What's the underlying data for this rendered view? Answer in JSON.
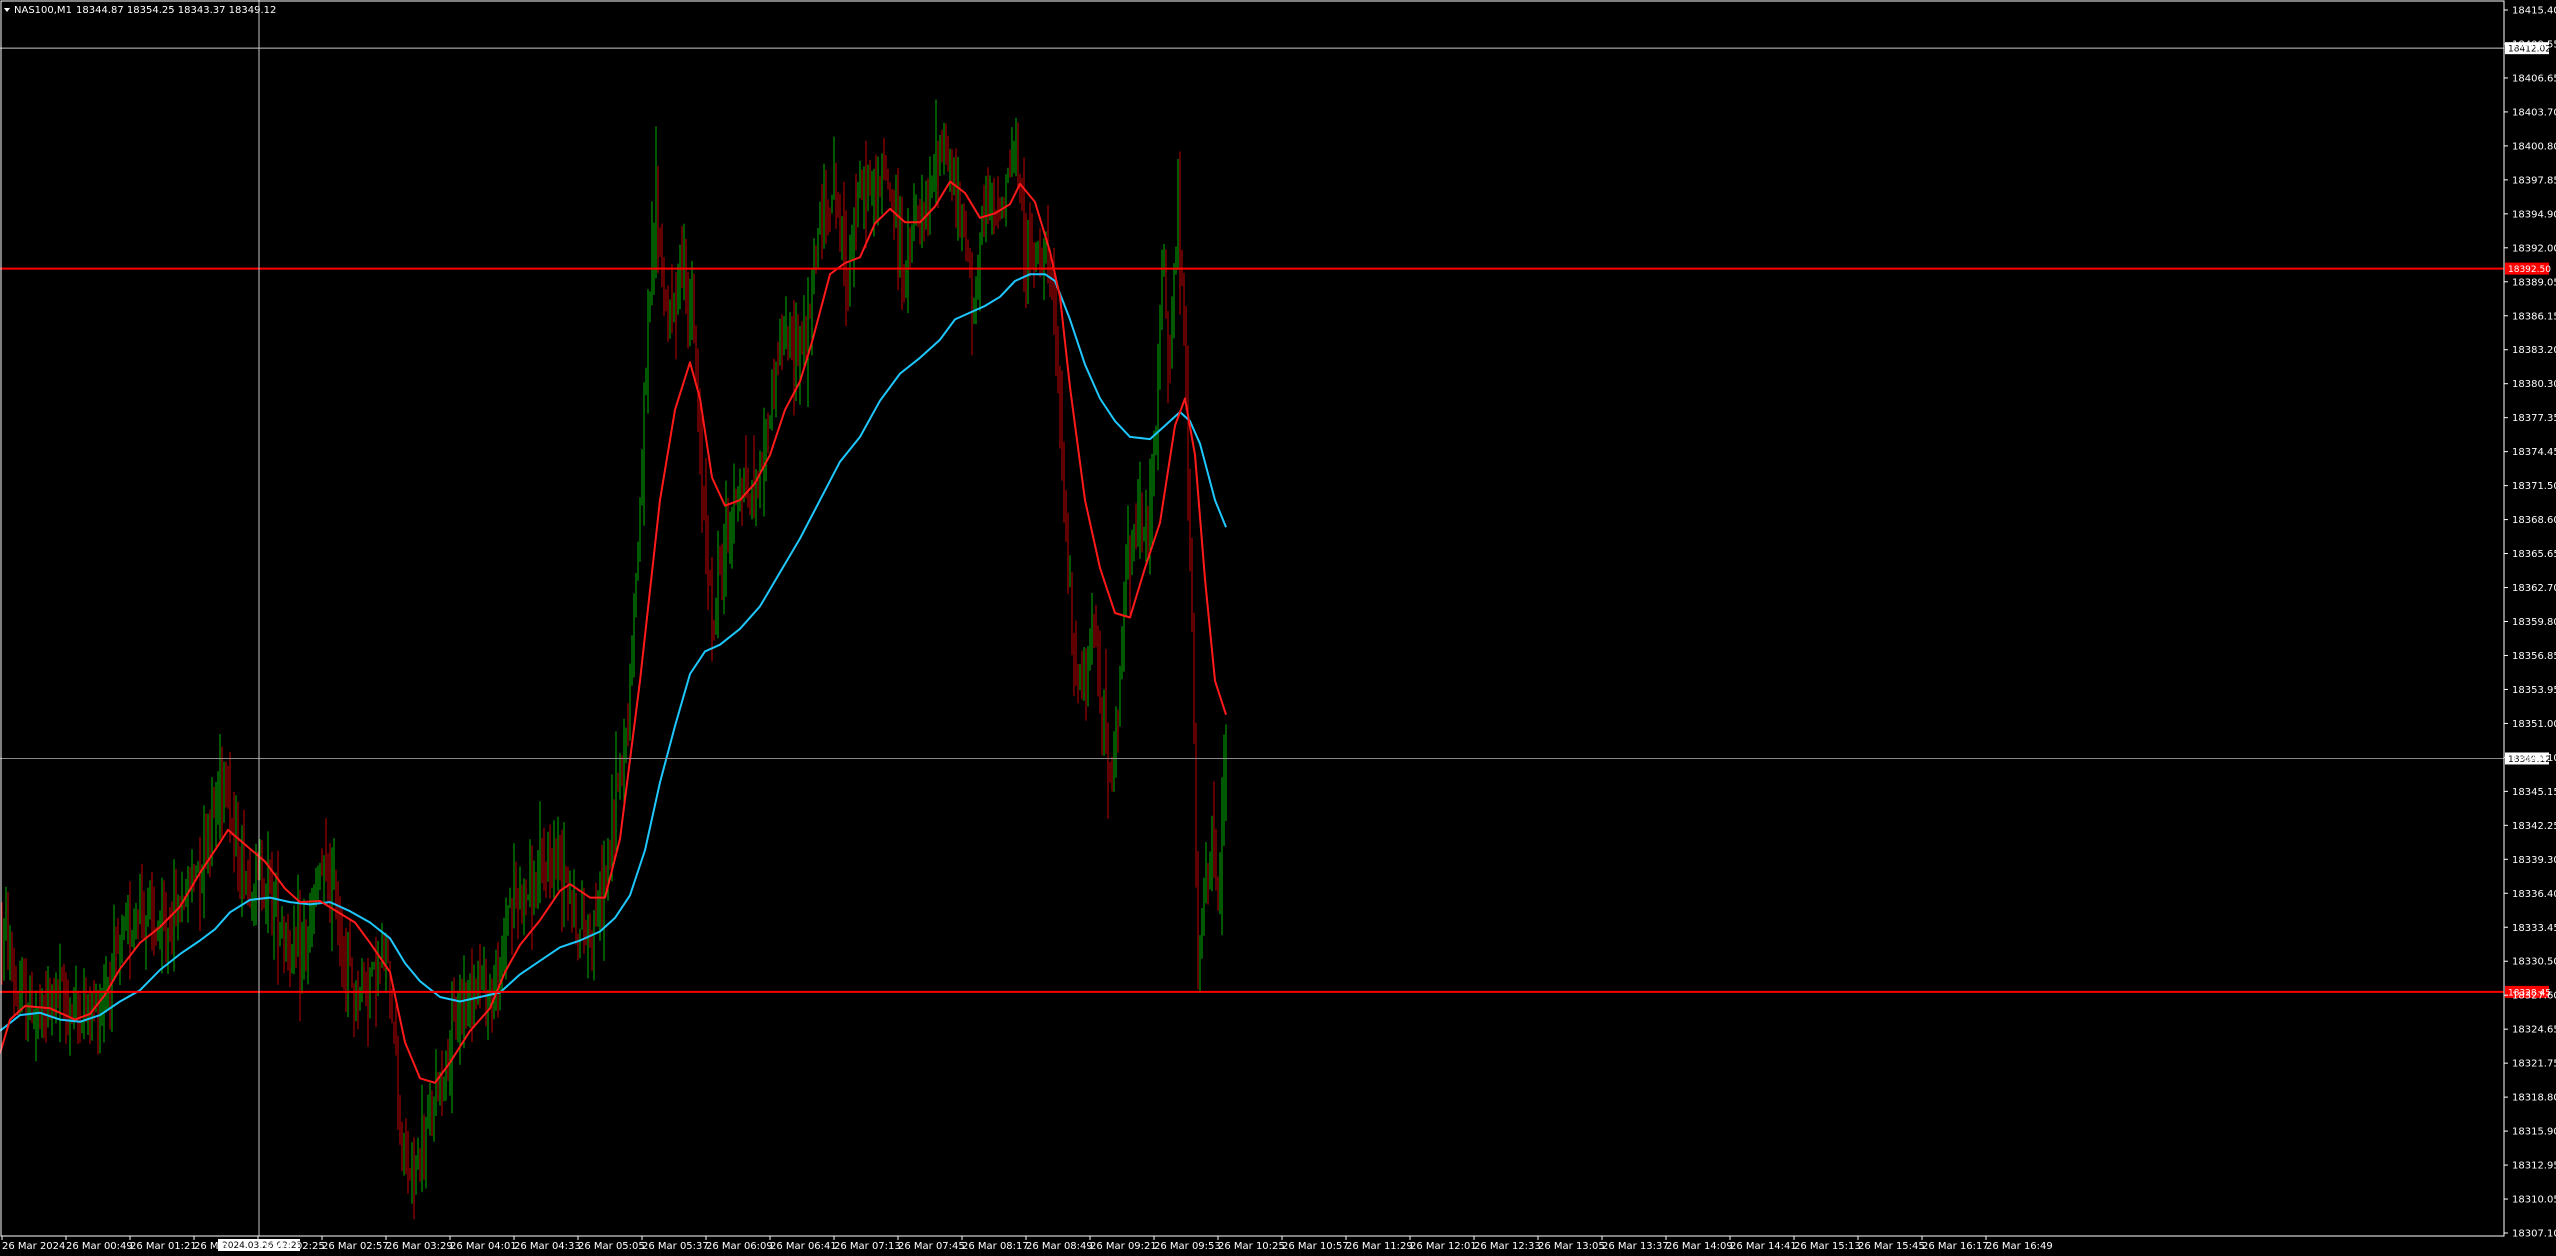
{
  "chart_data": {
    "type": "candlestick",
    "symbol_label": "NAS100,M1",
    "ohlc_header": "18344.87 18354.25 18343.37 18349.12",
    "time_range_label": "26 Mar 2024",
    "colors": {
      "background": "#000000",
      "candle_up": "#00b000",
      "candle_down": "#c00000",
      "ma_fast": "#ff1a1a",
      "ma_slow": "#1ec8ff",
      "hline": "#ff0000",
      "crosshair": "#c8c8c8",
      "axis": "#ffffff"
    },
    "y_axis": {
      "min": 18307.1,
      "max": 18415.4,
      "ticks": [
        "18415.40",
        "18409.55",
        "18406.65",
        "18403.70",
        "18400.80",
        "18397.85",
        "18394.90",
        "18392.00",
        "18389.05",
        "18386.15",
        "18383.20",
        "18380.30",
        "18377.35",
        "18374.45",
        "18371.50",
        "18368.60",
        "18365.65",
        "18362.70",
        "18359.80",
        "18356.85",
        "18353.95",
        "18351.00",
        "18348.10",
        "18345.15",
        "18342.25",
        "18339.30",
        "18336.40",
        "18333.45",
        "18330.50",
        "18327.60",
        "18324.65",
        "18321.75",
        "18318.80",
        "18315.90",
        "18312.95",
        "18310.05",
        "18307.10"
      ]
    },
    "x_axis": {
      "ticks": [
        "26 Mar 2024",
        "26 Mar 00:49",
        "26 Mar 01:21",
        "26 Mar",
        "26 Mar 02:25",
        "26 Mar 02:57",
        "26 Mar 03:29",
        "26 Mar 04:01",
        "26 Mar 04:33",
        "26 Mar 05:05",
        "26 Mar 05:37",
        "26 Mar 06:09",
        "26 Mar 06:41",
        "26 Mar 07:13",
        "26 Mar 07:45",
        "26 Mar 08:17",
        "26 Mar 08:49",
        "26 Mar 09:21",
        "26 Mar 09:53",
        "26 Mar 10:25",
        "26 Mar 10:57",
        "26 Mar 11:29",
        "26 Mar 12:01",
        "26 Mar 12:33",
        "26 Mar 13:05",
        "26 Mar 13:37",
        "26 Mar 14:09",
        "26 Mar 14:41",
        "26 Mar 15:13",
        "26 Mar 15:45",
        "26 Mar 16:17",
        "26 Mar 16:49"
      ]
    },
    "crosshair": {
      "price_label": "18412.02",
      "time_label": "2024.03.26 02:25",
      "price": 18412.02
    },
    "horizontal_lines": [
      {
        "price": 18392.5,
        "label": "18392.50"
      },
      {
        "price": 18328.45,
        "label": "18328.45"
      }
    ],
    "current_price": {
      "price": 18349.12,
      "label": "18349.12"
    },
    "price_path": [
      [
        0,
        18334.0
      ],
      [
        8,
        18333.0
      ],
      [
        15,
        18328.0
      ],
      [
        25,
        18327.5
      ],
      [
        40,
        18326.0
      ],
      [
        55,
        18328.5
      ],
      [
        70,
        18327.0
      ],
      [
        85,
        18326.5
      ],
      [
        100,
        18327.5
      ],
      [
        120,
        18332.0
      ],
      [
        140,
        18336.5
      ],
      [
        160,
        18333.0
      ],
      [
        180,
        18336.0
      ],
      [
        200,
        18340.5
      ],
      [
        215,
        18345.0
      ],
      [
        225,
        18349.0
      ],
      [
        235,
        18341.0
      ],
      [
        250,
        18338.0
      ],
      [
        265,
        18339.0
      ],
      [
        280,
        18335.0
      ],
      [
        295,
        18331.0
      ],
      [
        310,
        18333.5
      ],
      [
        320,
        18339.0
      ],
      [
        335,
        18337.0
      ],
      [
        345,
        18331.0
      ],
      [
        355,
        18328.0
      ],
      [
        370,
        18330.0
      ],
      [
        385,
        18331.0
      ],
      [
        395,
        18325.0
      ],
      [
        402,
        18314.0
      ],
      [
        410,
        18312.0
      ],
      [
        420,
        18313.5
      ],
      [
        430,
        18317.0
      ],
      [
        440,
        18320.5
      ],
      [
        450,
        18323.0
      ],
      [
        460,
        18327.0
      ],
      [
        475,
        18330.0
      ],
      [
        490,
        18328.5
      ],
      [
        500,
        18329.0
      ],
      [
        508,
        18336.5
      ],
      [
        520,
        18337.0
      ],
      [
        535,
        18337.5
      ],
      [
        550,
        18340.0
      ],
      [
        565,
        18340.5
      ],
      [
        578,
        18333.5
      ],
      [
        590,
        18334.0
      ],
      [
        600,
        18336.0
      ],
      [
        610,
        18340.5
      ],
      [
        618,
        18348.0
      ],
      [
        626,
        18351.0
      ],
      [
        634,
        18362.0
      ],
      [
        642,
        18375.0
      ],
      [
        650,
        18390.0
      ],
      [
        656,
        18399.0
      ],
      [
        662,
        18392.0
      ],
      [
        670,
        18387.0
      ],
      [
        680,
        18393.0
      ],
      [
        690,
        18390.0
      ],
      [
        695,
        18385.0
      ],
      [
        700,
        18375.0
      ],
      [
        708,
        18368.0
      ],
      [
        712,
        18360.0
      ],
      [
        720,
        18366.0
      ],
      [
        730,
        18370.0
      ],
      [
        740,
        18374.0
      ],
      [
        750,
        18372.0
      ],
      [
        760,
        18374.5
      ],
      [
        770,
        18380.0
      ],
      [
        780,
        18386.0
      ],
      [
        790,
        18385.5
      ],
      [
        800,
        18387.0
      ],
      [
        808,
        18386.0
      ],
      [
        815,
        18394.0
      ],
      [
        825,
        18398.0
      ],
      [
        835,
        18400.0
      ],
      [
        845,
        18392.0
      ],
      [
        855,
        18397.0
      ],
      [
        865,
        18400.0
      ],
      [
        875,
        18399.0
      ],
      [
        885,
        18401.0
      ],
      [
        895,
        18398.0
      ],
      [
        905,
        18391.0
      ],
      [
        915,
        18397.0
      ],
      [
        925,
        18396.0
      ],
      [
        935,
        18402.0
      ],
      [
        945,
        18404.0
      ],
      [
        955,
        18399.0
      ],
      [
        965,
        18395.0
      ],
      [
        975,
        18390.0
      ],
      [
        985,
        18398.0
      ],
      [
        995,
        18397.0
      ],
      [
        1005,
        18400.0
      ],
      [
        1015,
        18403.0
      ],
      [
        1025,
        18395.0
      ],
      [
        1035,
        18393.0
      ],
      [
        1045,
        18396.0
      ],
      [
        1052,
        18390.0
      ],
      [
        1060,
        18379.0
      ],
      [
        1068,
        18365.0
      ],
      [
        1075,
        18357.0
      ],
      [
        1085,
        18355.0
      ],
      [
        1095,
        18361.0
      ],
      [
        1105,
        18352.0
      ],
      [
        1112,
        18346.0
      ],
      [
        1118,
        18353.0
      ],
      [
        1125,
        18365.0
      ],
      [
        1135,
        18371.0
      ],
      [
        1145,
        18368.0
      ],
      [
        1155,
        18375.0
      ],
      [
        1162,
        18393.0
      ],
      [
        1170,
        18385.0
      ],
      [
        1178,
        18398.0
      ],
      [
        1186,
        18382.0
      ],
      [
        1192,
        18360.0
      ],
      [
        1198,
        18330.0
      ],
      [
        1204,
        18336.0
      ],
      [
        1212,
        18341.0
      ],
      [
        1220,
        18337.0
      ],
      [
        1226,
        18351.0
      ]
    ],
    "ma_fast_path": [
      [
        0,
        18323
      ],
      [
        10,
        18326
      ],
      [
        25,
        18327.2
      ],
      [
        50,
        18327
      ],
      [
        75,
        18326
      ],
      [
        90,
        18326.5
      ],
      [
        105,
        18328.2
      ],
      [
        120,
        18330.5
      ],
      [
        140,
        18332.8
      ],
      [
        160,
        18334.2
      ],
      [
        180,
        18336.0
      ],
      [
        200,
        18339.0
      ],
      [
        215,
        18341.0
      ],
      [
        228,
        18342.8
      ],
      [
        245,
        18341.5
      ],
      [
        265,
        18340.0
      ],
      [
        285,
        18337.6
      ],
      [
        300,
        18336.4
      ],
      [
        320,
        18336.5
      ],
      [
        340,
        18335.4
      ],
      [
        355,
        18334.6
      ],
      [
        370,
        18332.8
      ],
      [
        390,
        18330.2
      ],
      [
        405,
        18324.0
      ],
      [
        420,
        18320.8
      ],
      [
        435,
        18320.4
      ],
      [
        450,
        18322.2
      ],
      [
        470,
        18325.0
      ],
      [
        490,
        18327.0
      ],
      [
        505,
        18330.2
      ],
      [
        520,
        18332.6
      ],
      [
        540,
        18334.8
      ],
      [
        560,
        18337.4
      ],
      [
        570,
        18338.0
      ],
      [
        590,
        18336.8
      ],
      [
        605,
        18336.8
      ],
      [
        620,
        18342.0
      ],
      [
        640,
        18356.0
      ],
      [
        660,
        18372.0
      ],
      [
        675,
        18380.0
      ],
      [
        690,
        18384.2
      ],
      [
        700,
        18381.0
      ],
      [
        712,
        18374.0
      ],
      [
        725,
        18371.5
      ],
      [
        740,
        18372.0
      ],
      [
        755,
        18373.5
      ],
      [
        770,
        18376.0
      ],
      [
        785,
        18380.0
      ],
      [
        800,
        18382.5
      ],
      [
        812,
        18386.0
      ],
      [
        830,
        18392.0
      ],
      [
        845,
        18393.0
      ],
      [
        860,
        18393.5
      ],
      [
        875,
        18396.5
      ],
      [
        890,
        18397.8
      ],
      [
        905,
        18396.6
      ],
      [
        920,
        18396.6
      ],
      [
        935,
        18398.0
      ],
      [
        950,
        18400.2
      ],
      [
        965,
        18399.2
      ],
      [
        980,
        18397.0
      ],
      [
        995,
        18397.4
      ],
      [
        1010,
        18398.2
      ],
      [
        1020,
        18400.0
      ],
      [
        1035,
        18398.4
      ],
      [
        1050,
        18394.0
      ],
      [
        1060,
        18390.0
      ],
      [
        1070,
        18382.0
      ],
      [
        1085,
        18372.0
      ],
      [
        1100,
        18366.0
      ],
      [
        1115,
        18362.0
      ],
      [
        1130,
        18361.6
      ],
      [
        1145,
        18366.0
      ],
      [
        1160,
        18370.0
      ],
      [
        1175,
        18378.6
      ],
      [
        1185,
        18381.0
      ],
      [
        1195,
        18376.0
      ],
      [
        1205,
        18365.0
      ],
      [
        1215,
        18356.0
      ],
      [
        1226,
        18353.0
      ]
    ],
    "ma_slow_path": [
      [
        0,
        18325.0
      ],
      [
        20,
        18326.4
      ],
      [
        40,
        18326.6
      ],
      [
        60,
        18326.0
      ],
      [
        80,
        18325.8
      ],
      [
        100,
        18326.4
      ],
      [
        120,
        18327.6
      ],
      [
        140,
        18328.6
      ],
      [
        160,
        18330.4
      ],
      [
        180,
        18331.8
      ],
      [
        200,
        18333.0
      ],
      [
        215,
        18334.0
      ],
      [
        230,
        18335.5
      ],
      [
        250,
        18336.6
      ],
      [
        270,
        18336.8
      ],
      [
        290,
        18336.4
      ],
      [
        310,
        18336.2
      ],
      [
        330,
        18336.4
      ],
      [
        350,
        18335.6
      ],
      [
        370,
        18334.6
      ],
      [
        390,
        18333.2
      ],
      [
        405,
        18331.0
      ],
      [
        420,
        18329.4
      ],
      [
        440,
        18328.0
      ],
      [
        460,
        18327.6
      ],
      [
        480,
        18328.0
      ],
      [
        500,
        18328.4
      ],
      [
        520,
        18330.0
      ],
      [
        540,
        18331.2
      ],
      [
        560,
        18332.4
      ],
      [
        580,
        18333.0
      ],
      [
        600,
        18333.8
      ],
      [
        615,
        18335.0
      ],
      [
        630,
        18337.0
      ],
      [
        645,
        18341.0
      ],
      [
        660,
        18347.0
      ],
      [
        675,
        18352.0
      ],
      [
        690,
        18356.6
      ],
      [
        705,
        18358.6
      ],
      [
        720,
        18359.2
      ],
      [
        740,
        18360.6
      ],
      [
        760,
        18362.6
      ],
      [
        780,
        18365.6
      ],
      [
        800,
        18368.6
      ],
      [
        820,
        18372.0
      ],
      [
        840,
        18375.4
      ],
      [
        860,
        18377.6
      ],
      [
        880,
        18380.8
      ],
      [
        900,
        18383.2
      ],
      [
        920,
        18384.6
      ],
      [
        940,
        18386.2
      ],
      [
        955,
        18388.0
      ],
      [
        970,
        18388.6
      ],
      [
        985,
        18389.2
      ],
      [
        1000,
        18390.0
      ],
      [
        1015,
        18391.4
      ],
      [
        1030,
        18392.0
      ],
      [
        1045,
        18392.0
      ],
      [
        1055,
        18391.4
      ],
      [
        1070,
        18388.0
      ],
      [
        1085,
        18384.0
      ],
      [
        1100,
        18381.0
      ],
      [
        1115,
        18379.0
      ],
      [
        1130,
        18377.6
      ],
      [
        1150,
        18377.4
      ],
      [
        1165,
        18378.6
      ],
      [
        1180,
        18379.8
      ],
      [
        1190,
        18379.0
      ],
      [
        1200,
        18377.0
      ],
      [
        1215,
        18372.0
      ],
      [
        1226,
        18369.6
      ]
    ]
  }
}
